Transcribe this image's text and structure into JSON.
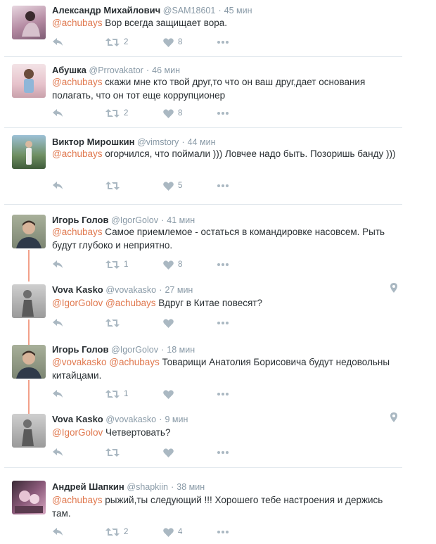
{
  "colors": {
    "mention": "#e0784e",
    "icon": "#aab8c2",
    "thread_line": "#f2a08a",
    "separator": "#e1e8ed"
  },
  "tweets": [
    {
      "name": "Александр Михайлович",
      "handle": "@SAM18601",
      "time": "45 мин",
      "mentions": "@achubays",
      "text": " Вор всегда защищает вора.",
      "retweets": "2",
      "likes": "8",
      "avatar_icon": "user-photo-avatar"
    },
    {
      "name": "Абушка",
      "handle": "@Prrovakator",
      "time": "46 мин",
      "mentions": "@achubays",
      "text": " скажи мне кто твой друг,то что он ваш друг,дает основания полагать, что он тот еще коррупционер",
      "retweets": "2",
      "likes": "8",
      "avatar_icon": "user-photo-avatar"
    },
    {
      "name": "Виктор Мирошкин",
      "handle": "@vimstory",
      "time": "44 мин",
      "mentions": "@achubays",
      "text": " огорчился, что поймали ))) Ловчее надо быть. Позоришь банду )))",
      "retweets": "",
      "likes": "5",
      "avatar_icon": "user-photo-avatar"
    },
    {
      "name": "Игорь Голов",
      "handle": "@IgorGolov",
      "time": "41 мин",
      "mentions": "@achubays",
      "text": " Самое приемлемое - остаться в командировке насовсем. Рыть будут глубоко и неприятно.",
      "retweets": "1",
      "likes": "8",
      "avatar_icon": "user-photo-avatar"
    },
    {
      "name": "Vova Kasko",
      "handle": "@vovakasko",
      "time": "27 мин",
      "mentions": "@IgorGolov @achubays",
      "text": " Вдруг в Китае повесят?",
      "retweets": "",
      "likes": "",
      "avatar_icon": "user-photo-avatar",
      "location_icon": "location-pin-icon"
    },
    {
      "name": "Игорь Голов",
      "handle": "@IgorGolov",
      "time": "18 мин",
      "mentions": "@vovakasko @achubays",
      "text": " Товарищи Анатолия Борисовича будут недовольны китайцами.",
      "retweets": "1",
      "likes": "",
      "avatar_icon": "user-photo-avatar"
    },
    {
      "name": "Vova Kasko",
      "handle": "@vovakasko",
      "time": "9 мин",
      "mentions": "@IgorGolov",
      "text": " Четвертовать?",
      "retweets": "",
      "likes": "",
      "avatar_icon": "user-photo-avatar",
      "location_icon": "location-pin-icon"
    },
    {
      "name": "Андрей Шапкин",
      "handle": "@shapkiin",
      "time": "38 мин",
      "mentions": "@achubays",
      "text": " рыжий,ты следующий !!! Хорошего тебе настроения и держись там.",
      "retweets": "2",
      "likes": "4",
      "avatar_icon": "user-photo-avatar"
    }
  ]
}
